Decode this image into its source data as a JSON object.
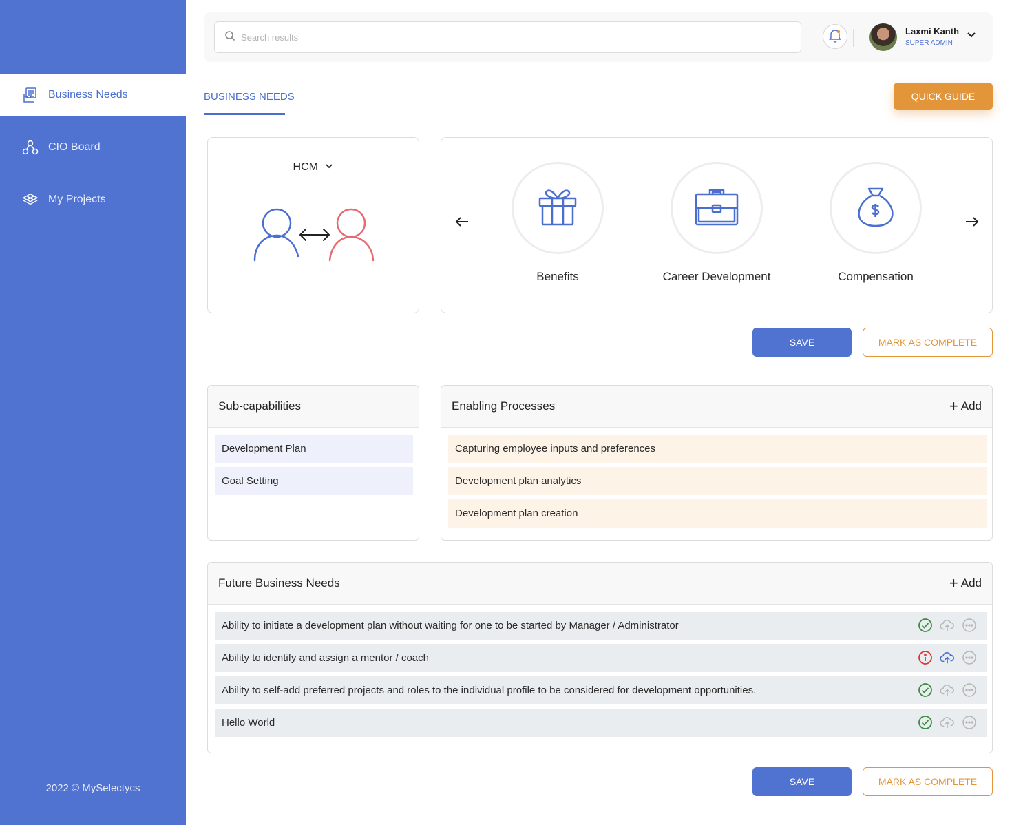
{
  "sidebar": {
    "items": [
      {
        "label": "Business Needs",
        "icon": "document-stack-icon"
      },
      {
        "label": "CIO Board",
        "icon": "network-nodes-icon"
      },
      {
        "label": "My Projects",
        "icon": "layers-icon"
      }
    ],
    "footer": "2022 ©  MySelectycs"
  },
  "topbar": {
    "search_placeholder": "Search results",
    "user_name": "Laxmi Kanth",
    "user_role": "SUPER ADMIN"
  },
  "tabs": {
    "active": "BUSINESS NEEDS"
  },
  "quick_guide_label": "QUICK GUIDE",
  "hcm": {
    "selected": "HCM"
  },
  "capabilities": [
    {
      "label": "Benefits",
      "icon": "gift-icon"
    },
    {
      "label": "Career Development",
      "icon": "briefcase-icon"
    },
    {
      "label": "Compensation",
      "icon": "money-bag-icon"
    }
  ],
  "actions": {
    "save": "SAVE",
    "complete": "MARK AS COMPLETE"
  },
  "subcapabilities": {
    "title": "Sub-capabilities",
    "items": [
      "Development Plan",
      "Goal Setting"
    ]
  },
  "enabling_processes": {
    "title": "Enabling Processes",
    "add": "Add",
    "items": [
      "Capturing employee inputs and preferences",
      "Development plan analytics",
      "Development plan creation"
    ]
  },
  "future_needs": {
    "title": "Future Business Needs",
    "add": "Add",
    "items": [
      {
        "text": "Ability to initiate a development plan without waiting for one to be started by Manager / Administrator",
        "status": "complete"
      },
      {
        "text": "Ability to identify and assign a mentor / coach",
        "status": "alert"
      },
      {
        "text": "Ability to self-add preferred projects and roles to the individual profile to be considered for development opportunities.",
        "status": "complete"
      },
      {
        "text": "Hello World",
        "status": "complete"
      }
    ]
  },
  "colors": {
    "primary": "#5073d1",
    "accent": "#e3953a",
    "success": "#3d8b45",
    "danger": "#d9363e",
    "person_blue": "#4b6fd0",
    "person_red": "#e66a6f"
  }
}
